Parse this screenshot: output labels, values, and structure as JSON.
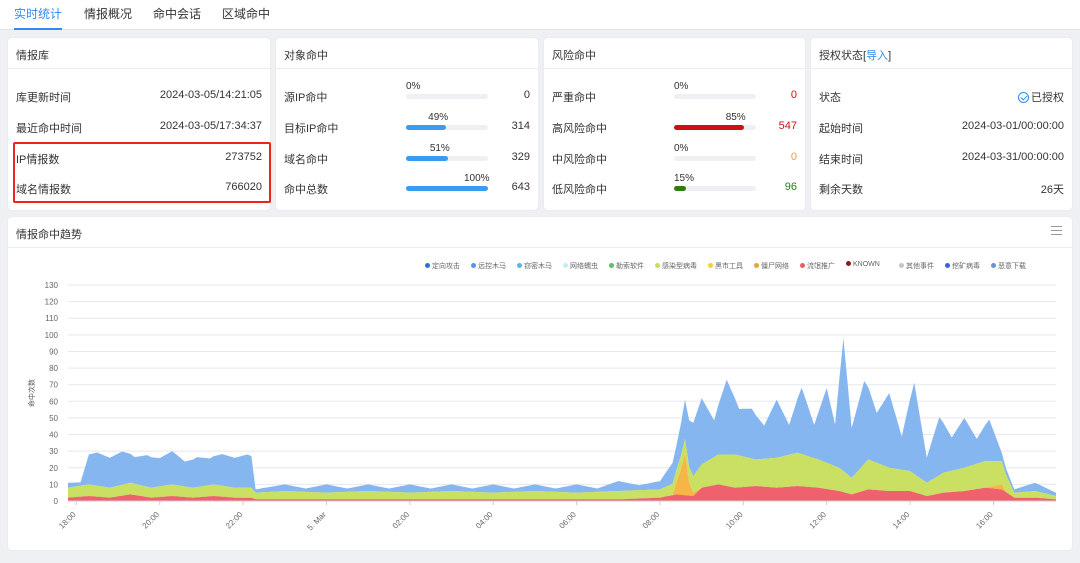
{
  "tabs": [
    {
      "label": "实时统计",
      "active": true
    },
    {
      "label": "情报概况",
      "active": false
    },
    {
      "label": "命中会话",
      "active": false
    },
    {
      "label": "区域命中",
      "active": false
    }
  ],
  "intel_db": {
    "title": "情报库",
    "rows": [
      {
        "label": "库更新时间",
        "value": "2024-03-05/14:21:05"
      },
      {
        "label": "最近命中时间",
        "value": "2024-03-05/17:34:37"
      },
      {
        "label": "IP情报数",
        "value": "273752"
      },
      {
        "label": "域名情报数",
        "value": "766020"
      }
    ]
  },
  "object_hit": {
    "title": "对象命中",
    "rows": [
      {
        "label": "源IP命中",
        "percent_label": "0%",
        "percent": 0,
        "value": "0"
      },
      {
        "label": "目标IP命中",
        "percent_label": "49%",
        "percent": 49,
        "value": "314"
      },
      {
        "label": "域名命中",
        "percent_label": "51%",
        "percent": 51,
        "value": "329"
      },
      {
        "label": "命中总数",
        "percent_label": "100%",
        "percent": 100,
        "value": "643"
      }
    ]
  },
  "risk_hit": {
    "title": "风险命中",
    "rows": [
      {
        "label": "严重命中",
        "percent_label": "0%",
        "percent": 0,
        "value": "0",
        "color": "#cc1111"
      },
      {
        "label": "高风险命中",
        "percent_label": "85%",
        "percent": 85,
        "value": "547",
        "color": "#cc1111"
      },
      {
        "label": "中风险命中",
        "percent_label": "0%",
        "percent": 0,
        "value": "0",
        "color": "#e6a23c"
      },
      {
        "label": "低风险命中",
        "percent_label": "15%",
        "percent": 15,
        "value": "96",
        "color": "#2e7d12"
      }
    ]
  },
  "license": {
    "title": "授权状态",
    "import_label": "导入",
    "rows": [
      {
        "label": "状态",
        "value": "已授权"
      },
      {
        "label": "起始时间",
        "value": "2024-03-01/00:00:00"
      },
      {
        "label": "结束时间",
        "value": "2024-03-31/00:00:00"
      },
      {
        "label": "剩余天数",
        "value": "26天"
      }
    ]
  },
  "trend": {
    "title": "情报命中趋势"
  },
  "colors": {
    "accent": "#2d8cf0",
    "bar_blue": "#3a9bf0",
    "area_blue": "#7fb2ef",
    "area_green": "#c6de5a",
    "area_red": "#ee5a65",
    "area_orange": "#f5b23c"
  },
  "chart_data": {
    "type": "area",
    "title": "",
    "ylabel": "命中次数",
    "ylim": [
      0,
      130
    ],
    "yticks": [
      0,
      10,
      20,
      30,
      40,
      50,
      60,
      70,
      80,
      90,
      100,
      110,
      120,
      130
    ],
    "x_range_hours": [
      17.8,
      41.5
    ],
    "xticks": [
      {
        "label": "18:00",
        "hour": 18
      },
      {
        "label": "20:00",
        "hour": 20
      },
      {
        "label": "22:00",
        "hour": 22
      },
      {
        "label": "5. Mar",
        "hour": 24
      },
      {
        "label": "02:00",
        "hour": 26
      },
      {
        "label": "04:00",
        "hour": 28
      },
      {
        "label": "06:00",
        "hour": 30
      },
      {
        "label": "08:00",
        "hour": 32
      },
      {
        "label": "10:00",
        "hour": 34
      },
      {
        "label": "12:00",
        "hour": 36
      },
      {
        "label": "14:00",
        "hour": 38
      },
      {
        "label": "16:00",
        "hour": 40
      }
    ],
    "legend": [
      {
        "name": "定向攻击",
        "color": "#2f6fd6"
      },
      {
        "name": "远控木马",
        "color": "#5b8ff0"
      },
      {
        "name": "窃密木马",
        "color": "#58b6e6"
      },
      {
        "name": "网络蠕虫",
        "color": "#c4ecf7"
      },
      {
        "name": "勒索软件",
        "color": "#5cbf6a"
      },
      {
        "name": "感染型病毒",
        "color": "#c6de5a"
      },
      {
        "name": "黑市工具",
        "color": "#f4d03f"
      },
      {
        "name": "僵尸网络",
        "color": "#e6a23c"
      },
      {
        "name": "流氓推广",
        "color": "#ee5a65"
      },
      {
        "name": "KNOWN",
        "color": "#8b1a1a"
      },
      {
        "name": "其他事件",
        "color": "#c0c4cc"
      },
      {
        "name": "挖矿病毒",
        "color": "#3d5fd9"
      },
      {
        "name": "恶意下载",
        "color": "#6d8fe0"
      }
    ],
    "series": [
      {
        "name": "流氓推广",
        "color": "#ee5a65",
        "points": [
          [
            17.8,
            2
          ],
          [
            18.3,
            3
          ],
          [
            18.8,
            2
          ],
          [
            19.3,
            4
          ],
          [
            19.8,
            2
          ],
          [
            20.3,
            3
          ],
          [
            20.8,
            2
          ],
          [
            21.3,
            3
          ],
          [
            21.8,
            2
          ],
          [
            22.2,
            2
          ],
          [
            22.3,
            1
          ],
          [
            23,
            1
          ],
          [
            24,
            1
          ],
          [
            25,
            1
          ],
          [
            26,
            1
          ],
          [
            27,
            1
          ],
          [
            28,
            1
          ],
          [
            29,
            1
          ],
          [
            30,
            1
          ],
          [
            31,
            1
          ],
          [
            32,
            2
          ],
          [
            32.4,
            4
          ],
          [
            32.8,
            3
          ],
          [
            33,
            8
          ],
          [
            33.4,
            10
          ],
          [
            33.8,
            8
          ],
          [
            34.3,
            9
          ],
          [
            34.8,
            8
          ],
          [
            35.3,
            9
          ],
          [
            35.8,
            8
          ],
          [
            36.3,
            6
          ],
          [
            36.6,
            4
          ],
          [
            37,
            7
          ],
          [
            37.5,
            6
          ],
          [
            38,
            6
          ],
          [
            38.4,
            3
          ],
          [
            38.8,
            5
          ],
          [
            39.3,
            6
          ],
          [
            39.8,
            8
          ],
          [
            40.2,
            7
          ],
          [
            40.5,
            2
          ],
          [
            41,
            2
          ],
          [
            41.5,
            1
          ]
        ]
      },
      {
        "name": "僵尸网络",
        "color": "#f5b23c",
        "points": [
          [
            17.8,
            0
          ],
          [
            32.3,
            0
          ],
          [
            32.5,
            15
          ],
          [
            32.6,
            25
          ],
          [
            32.7,
            8
          ],
          [
            32.8,
            2
          ],
          [
            33,
            0
          ],
          [
            39.8,
            0
          ],
          [
            40.2,
            3
          ],
          [
            40.3,
            0
          ],
          [
            41.5,
            0
          ]
        ]
      },
      {
        "name": "感染型病毒",
        "color": "#c6de5a",
        "points": [
          [
            17.8,
            6
          ],
          [
            18.3,
            7
          ],
          [
            18.8,
            6
          ],
          [
            19.3,
            7
          ],
          [
            19.8,
            6
          ],
          [
            20.3,
            7
          ],
          [
            20.8,
            6
          ],
          [
            21.3,
            7
          ],
          [
            21.8,
            6
          ],
          [
            22.2,
            6
          ],
          [
            22.3,
            4
          ],
          [
            23,
            5
          ],
          [
            24,
            4
          ],
          [
            25,
            5
          ],
          [
            26,
            4
          ],
          [
            27,
            5
          ],
          [
            28,
            4
          ],
          [
            29,
            5
          ],
          [
            30,
            4
          ],
          [
            31,
            5
          ],
          [
            32,
            5
          ],
          [
            32.8,
            10
          ],
          [
            33,
            14
          ],
          [
            33.4,
            18
          ],
          [
            33.8,
            20
          ],
          [
            34.3,
            16
          ],
          [
            34.8,
            18
          ],
          [
            35.3,
            20
          ],
          [
            35.8,
            17
          ],
          [
            36.3,
            14
          ],
          [
            36.6,
            10
          ],
          [
            37,
            18
          ],
          [
            37.5,
            14
          ],
          [
            38,
            12
          ],
          [
            38.4,
            8
          ],
          [
            38.8,
            12
          ],
          [
            39.3,
            14
          ],
          [
            39.8,
            16
          ],
          [
            40.2,
            14
          ],
          [
            40.5,
            3
          ],
          [
            41,
            4
          ],
          [
            41.5,
            2
          ]
        ]
      },
      {
        "name": "远控木马",
        "color": "#7fb2ef",
        "points": [
          [
            17.8,
            3
          ],
          [
            18.1,
            2
          ],
          [
            18.3,
            18
          ],
          [
            18.5,
            20
          ],
          [
            18.8,
            18
          ],
          [
            19.1,
            20
          ],
          [
            19.4,
            16
          ],
          [
            19.7,
            19
          ],
          [
            20,
            17
          ],
          [
            20.3,
            20
          ],
          [
            20.6,
            15
          ],
          [
            20.9,
            18
          ],
          [
            21.2,
            16
          ],
          [
            21.5,
            19
          ],
          [
            21.8,
            18
          ],
          [
            22.1,
            20
          ],
          [
            22.2,
            19
          ],
          [
            22.3,
            2
          ],
          [
            23,
            4
          ],
          [
            23.5,
            2
          ],
          [
            24,
            5
          ],
          [
            24.5,
            2
          ],
          [
            25,
            4
          ],
          [
            25.5,
            2
          ],
          [
            26,
            5
          ],
          [
            26.5,
            2
          ],
          [
            27,
            4
          ],
          [
            27.5,
            2
          ],
          [
            28,
            5
          ],
          [
            28.5,
            2
          ],
          [
            29,
            4
          ],
          [
            29.5,
            2
          ],
          [
            30,
            5
          ],
          [
            30.5,
            2
          ],
          [
            31,
            6
          ],
          [
            31.5,
            3
          ],
          [
            32,
            5
          ],
          [
            32.4,
            15
          ],
          [
            32.7,
            28
          ],
          [
            33,
            40
          ],
          [
            33.3,
            22
          ],
          [
            33.6,
            45
          ],
          [
            33.9,
            28
          ],
          [
            34.2,
            30
          ],
          [
            34.5,
            20
          ],
          [
            34.8,
            35
          ],
          [
            35.1,
            18
          ],
          [
            35.4,
            40
          ],
          [
            35.7,
            20
          ],
          [
            36,
            45
          ],
          [
            36.2,
            25
          ],
          [
            36.4,
            80
          ],
          [
            36.6,
            30
          ],
          [
            36.9,
            50
          ],
          [
            37.2,
            30
          ],
          [
            37.5,
            45
          ],
          [
            37.8,
            20
          ],
          [
            38.1,
            55
          ],
          [
            38.4,
            15
          ],
          [
            38.7,
            35
          ],
          [
            39,
            20
          ],
          [
            39.3,
            30
          ],
          [
            39.6,
            15
          ],
          [
            39.9,
            25
          ],
          [
            40.2,
            5
          ],
          [
            40.5,
            2
          ],
          [
            41,
            5
          ],
          [
            41.5,
            2
          ]
        ]
      }
    ]
  }
}
